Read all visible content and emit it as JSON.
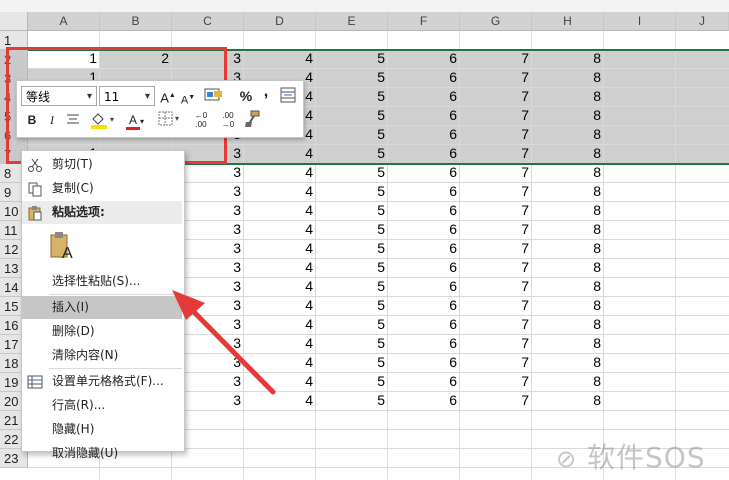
{
  "columns": [
    "A",
    "B",
    "C",
    "D",
    "E",
    "F",
    "G",
    "H",
    "I",
    "J"
  ],
  "rows": [
    "1",
    "2",
    "3",
    "4",
    "5",
    "6",
    "7",
    "8",
    "9",
    "10",
    "11",
    "12",
    "13",
    "14",
    "15",
    "16",
    "17",
    "18",
    "19",
    "20",
    "21",
    "22",
    "23"
  ],
  "selected_rows": [
    "2",
    "3",
    "4",
    "5",
    "6",
    "7"
  ],
  "cell_values": {
    "A2": "1",
    "B2": "2",
    "A3": "1",
    "A7": "1"
  },
  "row_values_cols_C_to_H": [
    "3",
    "4",
    "5",
    "6",
    "7",
    "8"
  ],
  "data_row_range": [
    2,
    20
  ],
  "mini_toolbar": {
    "font_name": "等线",
    "font_size": "11",
    "grow_font": "A",
    "shrink_font": "A",
    "percent": "%",
    "comma": ",",
    "bold": "B",
    "italic": "I",
    "font_color_letter": "A",
    "increase_decimal": "←0 .00",
    "decrease_decimal": ".00 →0"
  },
  "context_menu": {
    "items": [
      {
        "label": "剪切(T)",
        "icon": "scissors-icon"
      },
      {
        "label": "复制(C)",
        "icon": "copy-icon"
      },
      {
        "label": "粘贴选项:",
        "icon": "paste-icon",
        "header": true
      },
      {
        "label": "",
        "icon": "paste-option-icon",
        "option": true
      },
      {
        "label": "选择性粘贴(S)...",
        "icon": ""
      },
      {
        "label": "插入(I)",
        "icon": "",
        "highlighted": true
      },
      {
        "label": "删除(D)",
        "icon": ""
      },
      {
        "label": "清除内容(N)",
        "icon": ""
      },
      {
        "label": "设置单元格格式(F)...",
        "icon": "format-cells-icon"
      },
      {
        "label": "行高(R)...",
        "icon": ""
      },
      {
        "label": "隐藏(H)",
        "icon": ""
      },
      {
        "label": "取消隐藏(U)",
        "icon": ""
      }
    ]
  },
  "colors": {
    "selection_border": "#217346",
    "annotation_red": "#e53a3a",
    "selected_row_fill": "#cfcfcf"
  },
  "watermark": "软件SOS"
}
